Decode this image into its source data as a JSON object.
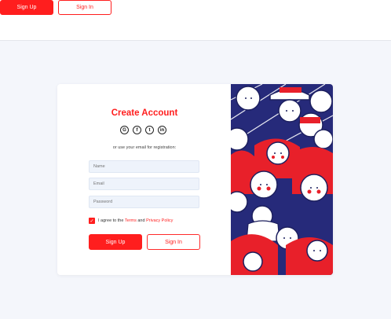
{
  "topbar": {
    "signup_label": "Sign Up",
    "signin_label": "Sign In"
  },
  "form": {
    "title": "Create Account",
    "social": [
      {
        "icon": "google-icon",
        "glyph": "G"
      },
      {
        "icon": "facebook-icon",
        "glyph": "f"
      },
      {
        "icon": "twitter-icon",
        "glyph": "t"
      },
      {
        "icon": "linkedin-icon",
        "glyph": "in"
      }
    ],
    "subtext": "or use your email for registration:",
    "name_placeholder": "Name",
    "email_placeholder": "Email",
    "password_placeholder": "Password",
    "agree_prefix": "I agree to the",
    "terms_label": "Terms",
    "agree_and": "and",
    "privacy_label": "Privacy Policy",
    "checkbox_checked": true,
    "signup_label": "Sign Up",
    "signin_label": "Sign In"
  },
  "colors": {
    "accent": "#ff1e1e",
    "navy": "#262a7a",
    "background": "#f4f6fb"
  }
}
